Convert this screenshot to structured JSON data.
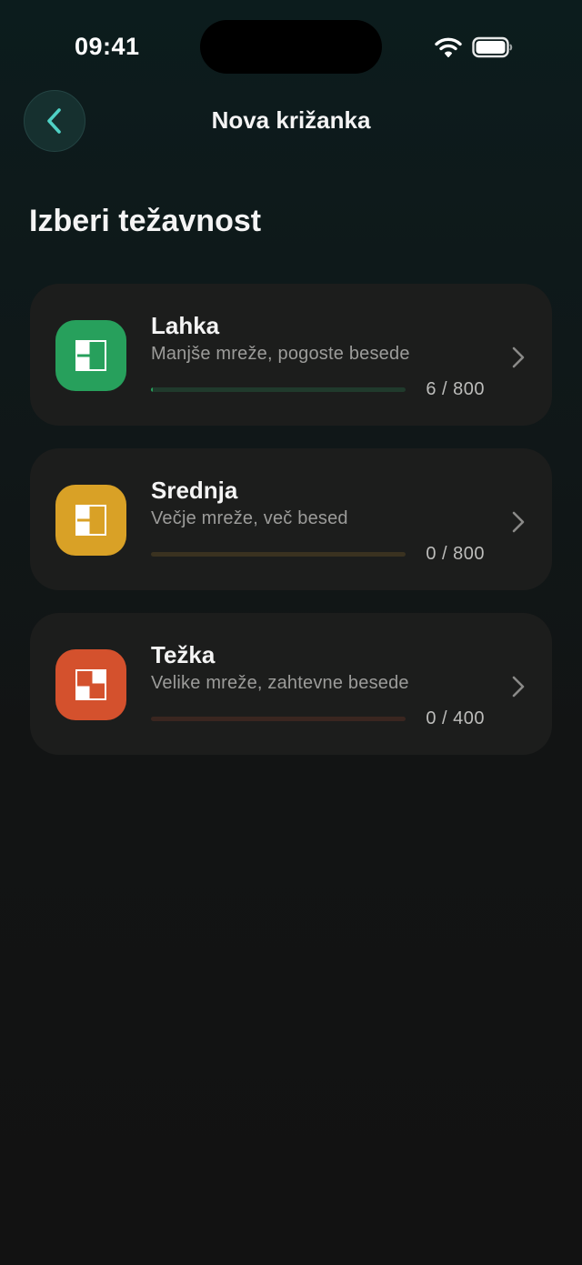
{
  "status_bar": {
    "time": "09:41",
    "icons": [
      "wifi-icon",
      "battery-icon"
    ]
  },
  "nav": {
    "back_icon": "chevron-left-icon",
    "title": "Nova križanka"
  },
  "section_title": "Izberi težavnost",
  "levels": [
    {
      "title": "Lahka",
      "subtitle": "Manjše mreže, pogoste besede",
      "progress_text": "6 / 800",
      "completed": 6,
      "total": 800,
      "icon": "crossword-grid-icon",
      "accent_color": "#27a05c",
      "track_color": "#203a2c"
    },
    {
      "title": "Srednja",
      "subtitle": "Večje mreže, več besed",
      "progress_text": "0 / 800",
      "completed": 0,
      "total": 800,
      "icon": "crossword-grid-icon",
      "accent_color": "#d9a126",
      "track_color": "#3a3220"
    },
    {
      "title": "Težka",
      "subtitle": "Velike mreže, zahtevne besede",
      "progress_text": "0 / 400",
      "completed": 0,
      "total": 400,
      "icon": "crossword-grid-icon",
      "accent_color": "#d4512d",
      "track_color": "#3a2620"
    }
  ]
}
